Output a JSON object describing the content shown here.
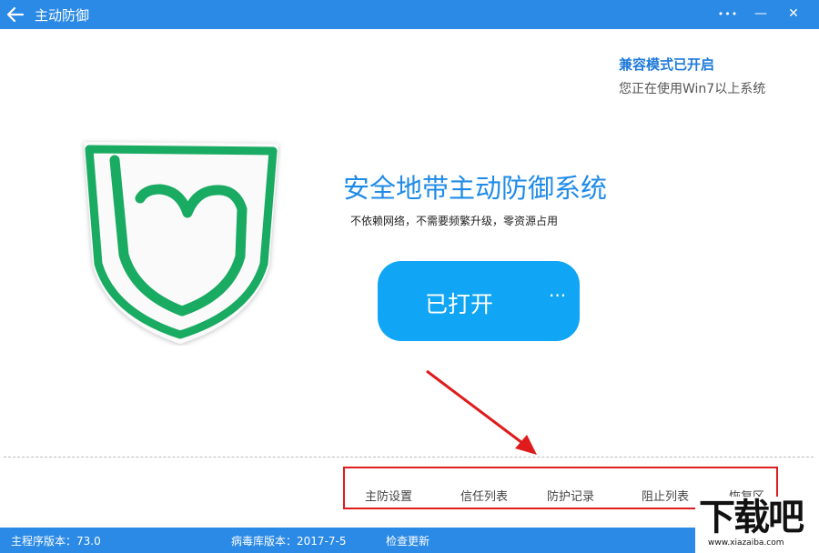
{
  "window": {
    "title": "主动防御",
    "controls": {
      "more": "•••",
      "minimize": "—",
      "close": "✕"
    }
  },
  "compat": {
    "title": "兼容模式已开启",
    "subtitle": "您正在使用Win7以上系统"
  },
  "main": {
    "heading": "安全地带主动防御系统",
    "description": "不依赖网络，不需要频繁升级，零资源占用",
    "toggle": {
      "label": "已打开",
      "more": "···",
      "state": "on"
    }
  },
  "nav": {
    "items": [
      {
        "label": "主防设置"
      },
      {
        "label": "信任列表"
      },
      {
        "label": "防护记录"
      },
      {
        "label": "阻止列表"
      },
      {
        "label": "恢复区"
      }
    ]
  },
  "status": {
    "main_version": "主程序版本：73.0",
    "virus_db_version": "病毒库版本：2017-7-5",
    "check_update": "检查更新"
  },
  "watermark": {
    "logo_text": "下载吧",
    "url": "www.xiazaiba.com"
  },
  "colors": {
    "titlebar": "#2b8ae6",
    "accent": "#1f8be8",
    "toggle": "#10a5f5",
    "shield_green": "#1aab62",
    "highlight_red": "#e01b1b"
  },
  "icons": {
    "back": "back-arrow-icon",
    "shield": "shield-logo-icon"
  }
}
